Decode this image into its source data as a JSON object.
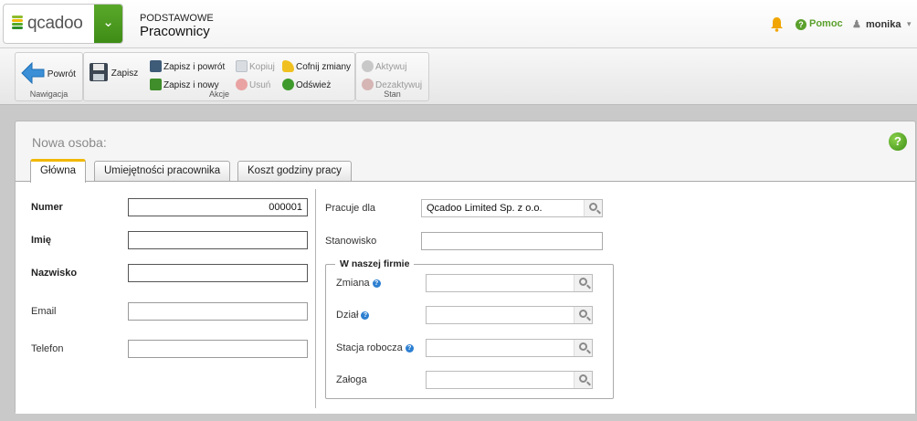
{
  "app": {
    "logo_text": "qcadoo"
  },
  "header": {
    "section": "PODSTAWOWE",
    "page": "Pracownicy",
    "help_label": "Pomoc",
    "user_name": "monika"
  },
  "ribbon": {
    "groups": {
      "navigation": {
        "label": "Nawigacja",
        "back": "Powrót"
      },
      "actions": {
        "label": "Akcje",
        "save": "Zapisz",
        "save_back": "Zapisz i powrót",
        "save_new": "Zapisz i nowy",
        "copy": "Kopiuj",
        "delete": "Usuń",
        "undo": "Cofnij zmiany",
        "refresh": "Odśwież"
      },
      "state": {
        "label": "Stan",
        "activate": "Aktywuj",
        "deactivate": "Dezaktywuj"
      }
    }
  },
  "form": {
    "title": "Nowa osoba:",
    "tabs": [
      {
        "label": "Główna",
        "active": true
      },
      {
        "label": "Umiejętności pracownika",
        "active": false
      },
      {
        "label": "Koszt godziny pracy",
        "active": false
      }
    ],
    "left": {
      "number": {
        "label": "Numer",
        "value": "000001"
      },
      "first_name": {
        "label": "Imię",
        "value": ""
      },
      "last_name": {
        "label": "Nazwisko",
        "value": ""
      },
      "email": {
        "label": "Email",
        "value": ""
      },
      "phone": {
        "label": "Telefon",
        "value": ""
      }
    },
    "right": {
      "works_for": {
        "label": "Pracuje dla",
        "value": "Qcadoo Limited Sp. z o.o."
      },
      "position": {
        "label": "Stanowisko",
        "value": ""
      },
      "company_section": {
        "legend": "W naszej firmie",
        "shift": {
          "label": "Zmiana",
          "value": ""
        },
        "division": {
          "label": "Dział",
          "value": ""
        },
        "workstation": {
          "label": "Stacja robocza",
          "value": ""
        },
        "crew": {
          "label": "Załoga",
          "value": ""
        }
      }
    }
  },
  "colors": {
    "accent_green": "#5aa02c",
    "tab_highlight": "#f0b800",
    "info_blue": "#2c7fd1"
  }
}
